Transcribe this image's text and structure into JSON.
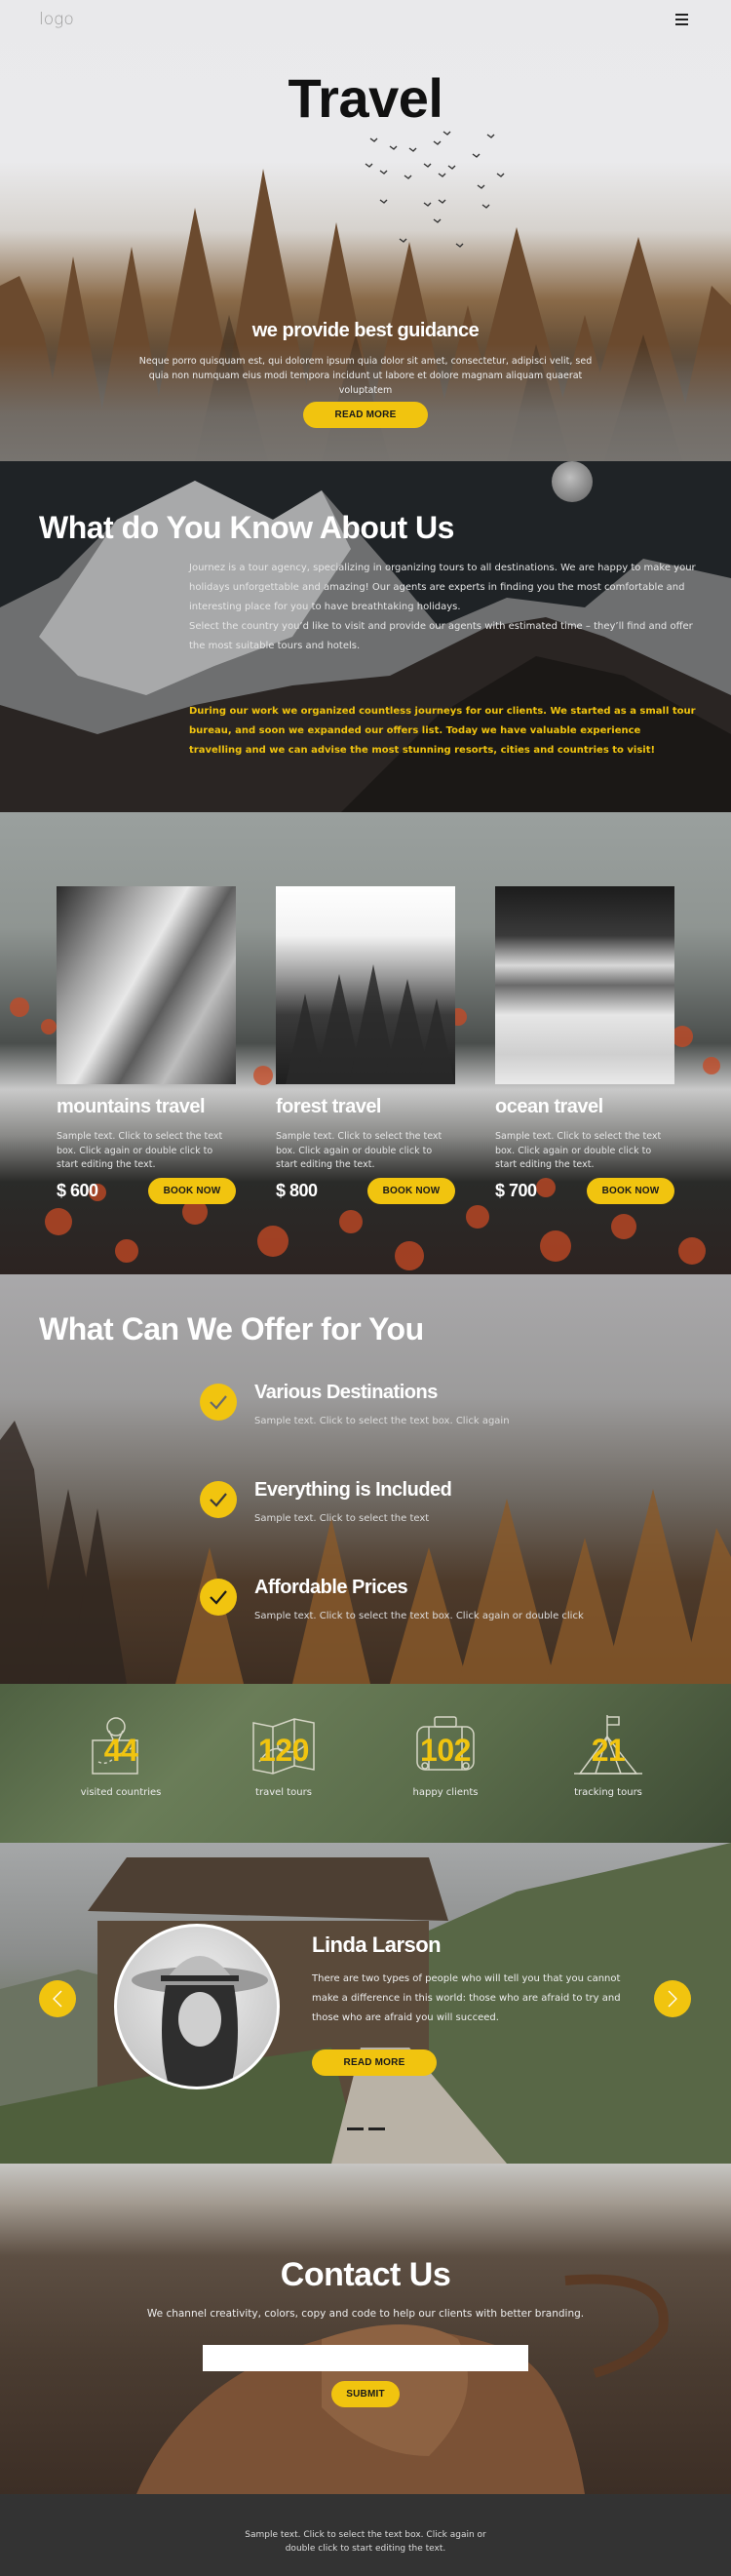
{
  "colors": {
    "accent": "#f1c40f",
    "footer_bg": "#333333"
  },
  "header": {
    "logo": "logo",
    "menu_icon": "hamburger-icon"
  },
  "hero": {
    "title": "Travel",
    "subtitle": "we provide best guidance",
    "description": "Neque porro quisquam est, qui dolorem ipsum quia dolor sit amet, consectetur, adipisci velit, sed quia non numquam eius modi tempora incidunt ut labore et dolore magnam aliquam quaerat voluptatem",
    "button": "READ MORE"
  },
  "about": {
    "title": "What do You Know About Us",
    "paragraph1_line1": "Journez is a tour agency, specializing in organizing tours to all destinations. We are happy to make your holidays unforgettable and amazing! Our agents are experts in finding you the most comfortable and interesting place for you to have breathtaking holidays.",
    "paragraph1_line2": "Select the country you’d like to visit and provide our agents with estimated time – they’ll find and offer the most suitable tours and hotels.",
    "paragraph2": "During our work we organized countless journeys for our clients. We started as a small tour bureau, and soon we expanded our offers list. Today we have valuable experience travelling and we can advise the most stunning resorts, cities and countries to visit!"
  },
  "tours": [
    {
      "title": "mountains travel",
      "text": "Sample text. Click to select the text box. Click again or double click to start editing the text.",
      "price": "$ 600",
      "button": "BOOK NOW",
      "image": "canyon-photo"
    },
    {
      "title": "forest travel",
      "text": "Sample text. Click to select the text box. Click again or double click to start editing the text.",
      "price": "$ 800",
      "button": "BOOK NOW",
      "image": "misty-forest-photo"
    },
    {
      "title": "ocean travel",
      "text": "Sample text. Click to select the text box. Click again or double click to start editing the text.",
      "price": "$ 700",
      "button": "BOOK NOW",
      "image": "ocean-waves-photo"
    }
  ],
  "offer": {
    "title": "What Can We Offer for You",
    "items": [
      {
        "title": "Various Destinations",
        "text": "Sample text. Click to select the text box. Click again",
        "icon": "check-icon"
      },
      {
        "title": "Everything is Included",
        "text": "Sample text. Click to select the text",
        "icon": "check-icon"
      },
      {
        "title": "Affordable Prices",
        "text": "Sample text. Click to select the text box. Click again or double click",
        "icon": "check-icon"
      }
    ]
  },
  "stats": [
    {
      "value": "44",
      "label": "visited countries",
      "icon": "map-pin-icon"
    },
    {
      "value": "120",
      "label": "travel tours",
      "icon": "folded-map-icon"
    },
    {
      "value": "102",
      "label": "happy clients",
      "icon": "suitcase-icon"
    },
    {
      "value": "21",
      "label": "tracking tours",
      "icon": "tent-flag-icon"
    }
  ],
  "testimonial": {
    "name": "Linda Larson",
    "quote": "There are two types of people who will tell you that you cannot make a difference in this world: those who are afraid to try and those who are afraid you will succeed.",
    "button": "READ MORE",
    "slide_count": 2,
    "active_slide": 1
  },
  "contact": {
    "title": "Contact Us",
    "subtitle": "We channel creativity, colors, copy and code to help our clients with better branding.",
    "input_value": "",
    "button": "SUBMIT"
  },
  "footer": {
    "text": "Sample text. Click to select the text box. Click again or double click to start editing the text."
  }
}
